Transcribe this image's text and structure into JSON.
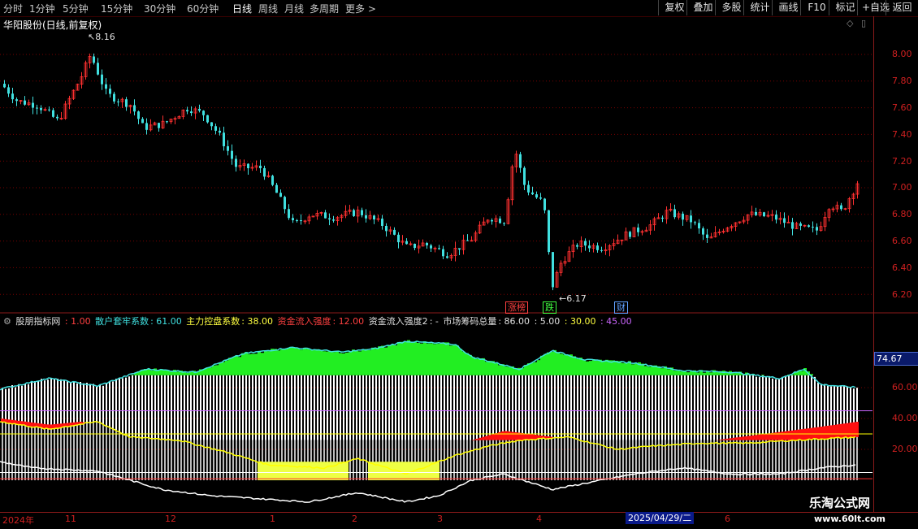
{
  "toolbar": {
    "periods": [
      "分时",
      "1分钟",
      "5分钟",
      "15分钟",
      "30分钟",
      "60分钟",
      "日线",
      "周线",
      "月线",
      "多周期",
      "更多 >"
    ],
    "active_period": "日线",
    "buttons": [
      "复权",
      "叠加",
      "多股",
      "统计",
      "画线",
      "F10",
      "标记",
      "+自选",
      "返回"
    ]
  },
  "chart_title": "华阳股份(日线,前复权)",
  "price_axis": [
    "8.00",
    "7.80",
    "7.60",
    "7.40",
    "7.20",
    "7.00",
    "6.80",
    "6.60",
    "6.40",
    "6.20"
  ],
  "annotations": {
    "high": "8.16",
    "low": "6.17"
  },
  "badges": {
    "up": "涨榜",
    "down": "跌",
    "money": "财"
  },
  "indicator": {
    "name": "股朋指标网",
    "v1": ": 1.00",
    "retail_label": "散户套牢系数",
    "retail_val": ": 61.00",
    "main_label": "主力控盘系数",
    "main_val": ": 38.00",
    "inflow_label": "资金流入强度",
    "inflow_val": ": 12.00",
    "inflow2_label": "资金流入强度2",
    "inflow2_val": ": -",
    "total_label": "市场筹码总量",
    "total_val": ": 86.00",
    "v5": ": 5.00",
    "v30": ": 30.00",
    "v45": ": 45.00",
    "current_value": "74.67",
    "axis": [
      "60.00",
      "40.00",
      "20.00"
    ]
  },
  "x_axis": {
    "labels": [
      "2024年",
      "11",
      "12",
      "1",
      "2",
      "3",
      "4",
      "6"
    ],
    "cursor_date": "2025/04/29/二"
  },
  "watermark": {
    "line1": "乐淘公式网",
    "line2": "www.60lt.com"
  },
  "colors": {
    "up": "#ff3030",
    "down": "#40e0e0",
    "green_fill": "#22ee22",
    "red_fill": "#ff1010",
    "yellow": "#ffff00",
    "violet": "#cc66ff",
    "grid": "#7a0000"
  }
}
